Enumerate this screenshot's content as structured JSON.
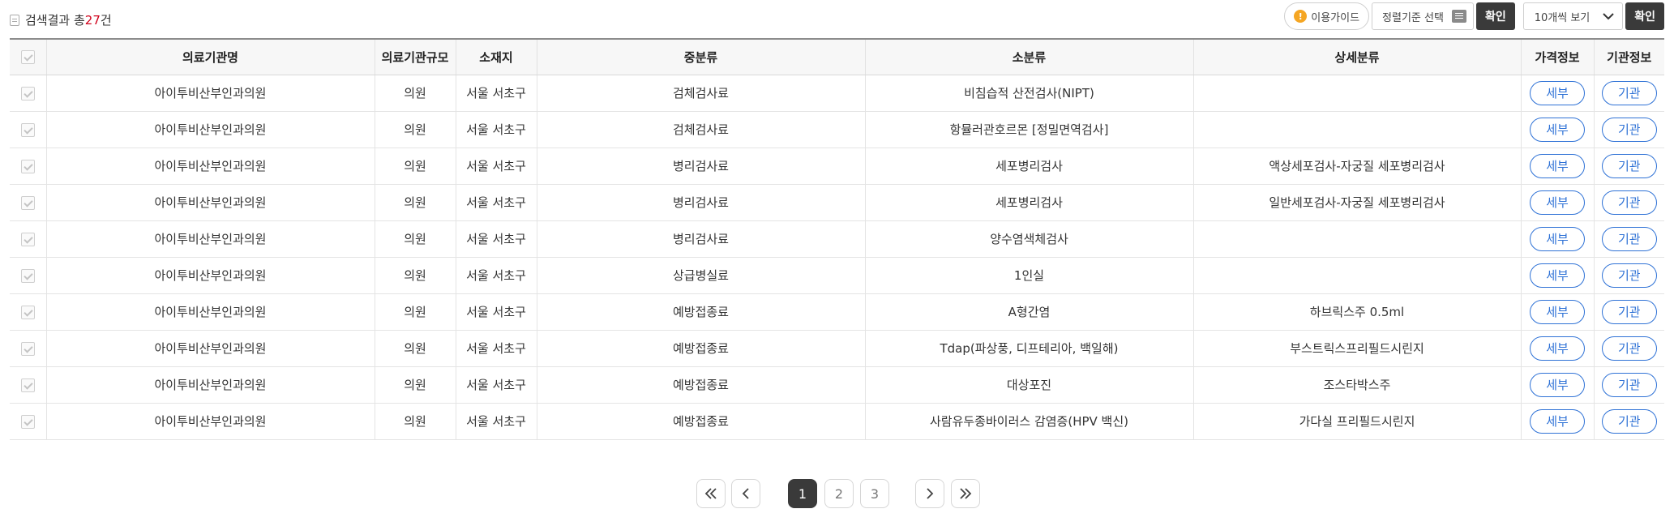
{
  "summary": {
    "prefix": "검색결과 총",
    "count": "27",
    "suffix": "건"
  },
  "toolbar": {
    "guide_label": "이용가이드",
    "sort_label": "정렬기준 선택",
    "confirm_label": "확인",
    "page_size_label": "10개씩 보기",
    "confirm2_label": "확인"
  },
  "table": {
    "headers": [
      "의료기관명",
      "의료기관규모",
      "소재지",
      "중분류",
      "소분류",
      "상세분류",
      "가격정보",
      "기관정보"
    ],
    "detail_label": "세부",
    "org_label": "기관",
    "rows": [
      {
        "name": "아이투비산부인과의원",
        "scale": "의원",
        "location": "서울 서초구",
        "mid": "검체검사료",
        "small": "비침습적 산전검사(NIPT)",
        "detail": ""
      },
      {
        "name": "아이투비산부인과의원",
        "scale": "의원",
        "location": "서울 서초구",
        "mid": "검체검사료",
        "small": "항뮬러관호르몬 [정밀면역검사]",
        "detail": ""
      },
      {
        "name": "아이투비산부인과의원",
        "scale": "의원",
        "location": "서울 서초구",
        "mid": "병리검사료",
        "small": "세포병리검사",
        "detail": "액상세포검사-자궁질 세포병리검사"
      },
      {
        "name": "아이투비산부인과의원",
        "scale": "의원",
        "location": "서울 서초구",
        "mid": "병리검사료",
        "small": "세포병리검사",
        "detail": "일반세포검사-자궁질 세포병리검사"
      },
      {
        "name": "아이투비산부인과의원",
        "scale": "의원",
        "location": "서울 서초구",
        "mid": "병리검사료",
        "small": "양수염색체검사",
        "detail": ""
      },
      {
        "name": "아이투비산부인과의원",
        "scale": "의원",
        "location": "서울 서초구",
        "mid": "상급병실료",
        "small": "1인실",
        "detail": ""
      },
      {
        "name": "아이투비산부인과의원",
        "scale": "의원",
        "location": "서울 서초구",
        "mid": "예방접종료",
        "small": "A형간염",
        "detail": "하브릭스주 0.5ml"
      },
      {
        "name": "아이투비산부인과의원",
        "scale": "의원",
        "location": "서울 서초구",
        "mid": "예방접종료",
        "small": "Tdap(파상풍, 디프테리아, 백일해)",
        "detail": "부스트릭스프리필드시린지"
      },
      {
        "name": "아이투비산부인과의원",
        "scale": "의원",
        "location": "서울 서초구",
        "mid": "예방접종료",
        "small": "대상포진",
        "detail": "조스타박스주"
      },
      {
        "name": "아이투비산부인과의원",
        "scale": "의원",
        "location": "서울 서초구",
        "mid": "예방접종료",
        "small": "사람유두종바이러스 감염증(HPV 백신)",
        "detail": "가다실 프리필드시린지"
      }
    ]
  },
  "pagination": {
    "pages": [
      "1",
      "2",
      "3"
    ],
    "current": "1"
  },
  "colors": {
    "accent": "#2f72d6",
    "count": "#d0021b",
    "dark_button": "#3a3a3a",
    "warning": "#f5a623"
  },
  "icons": [
    "document-icon",
    "warning-icon",
    "list-icon",
    "chevron-down-icon",
    "checkbox-icon",
    "double-chevron-left-icon",
    "chevron-left-icon",
    "chevron-right-icon",
    "double-chevron-right-icon"
  ]
}
